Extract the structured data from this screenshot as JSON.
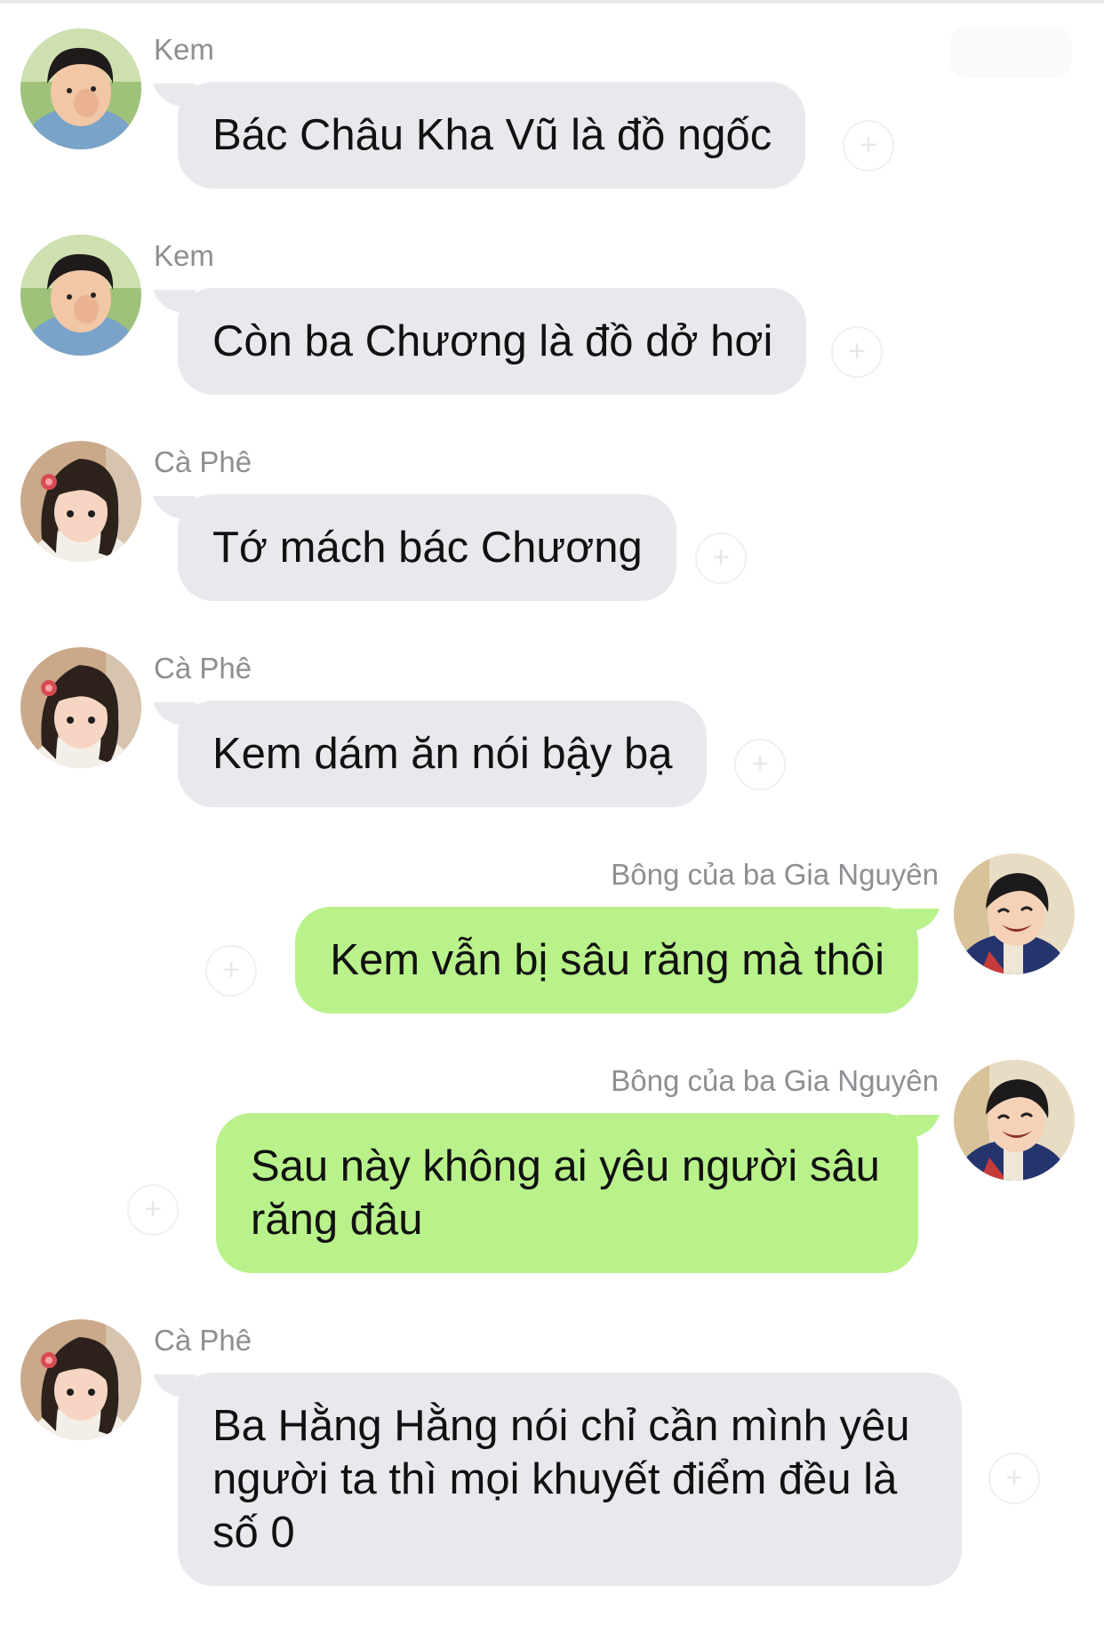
{
  "chat": {
    "messages": [
      {
        "sender": "Kem",
        "text": "Bác Châu Kha Vũ là đồ ngốc",
        "side": "left",
        "avatar": "boy-covering-face-avatar"
      },
      {
        "sender": "Kem",
        "text": "Còn ba Chương là đồ dở hơi",
        "side": "left",
        "avatar": "boy-covering-face-avatar"
      },
      {
        "sender": "Cà Phê",
        "text": "Tớ mách bác Chương",
        "side": "left",
        "avatar": "girl-with-hairclip-avatar"
      },
      {
        "sender": "Cà Phê",
        "text": "Kem dám ăn nói bậy bạ",
        "side": "left",
        "avatar": "girl-with-hairclip-avatar"
      },
      {
        "sender": "Bông của ba Gia Nguyên",
        "text": "Kem vẫn bị sâu răng mà thôi",
        "side": "right",
        "avatar": "smiling-boy-avatar"
      },
      {
        "sender": "Bông của ba Gia Nguyên",
        "text": "Sau này không ai yêu người sâu răng đâu",
        "side": "right",
        "avatar": "smiling-boy-avatar"
      },
      {
        "sender": "Cà Phê",
        "text": "Ba Hằng Hằng nói chỉ cần mình yêu người ta thì mọi khuyết điểm đều là số 0",
        "side": "left",
        "avatar": "girl-with-hairclip-avatar"
      }
    ]
  },
  "colors": {
    "incoming_bubble": "#e8e9ed",
    "outgoing_bubble": "#b9f28b",
    "sender_name": "#8e8e93",
    "message_text": "#111111"
  },
  "icons": {
    "reaction": "add-reaction-icon"
  }
}
